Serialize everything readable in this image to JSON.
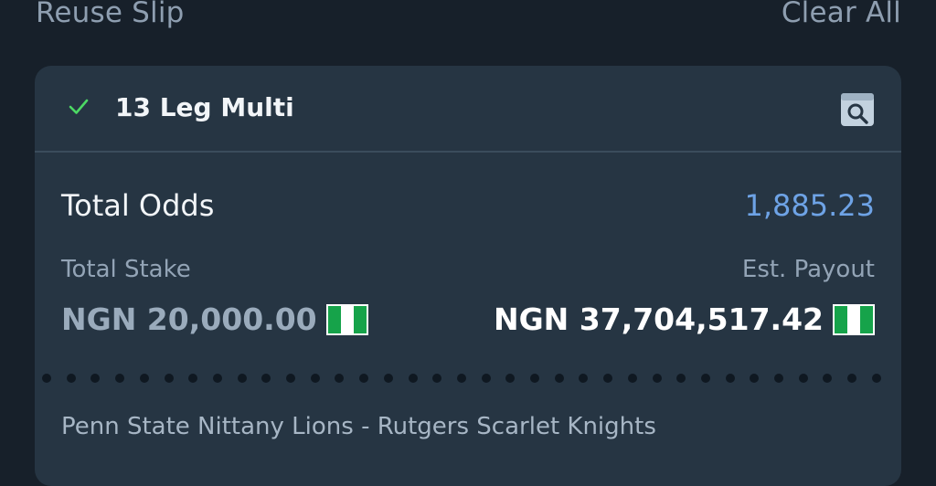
{
  "topbar": {
    "reuse_label": "Reuse Slip",
    "clear_label": "Clear All"
  },
  "slip": {
    "title": "13 Leg Multi",
    "status_icon": "check-icon",
    "action_icon": "receipt-search-icon",
    "total_odds_label": "Total Odds",
    "total_odds_value": "1,885.23",
    "total_stake_label": "Total Stake",
    "total_stake_value": "NGN 20,000.00",
    "est_payout_label": "Est. Payout",
    "est_payout_value": "NGN 37,704,517.42",
    "currency_flag": "nigeria-flag-icon",
    "first_leg_event": "Penn State Nittany Lions - Rutgers Scarlet Knights"
  },
  "colors": {
    "background": "#17202a",
    "card": "#263543",
    "accent": "#6ea3e6",
    "check": "#4cd964",
    "flag_green": "#16a34a"
  }
}
